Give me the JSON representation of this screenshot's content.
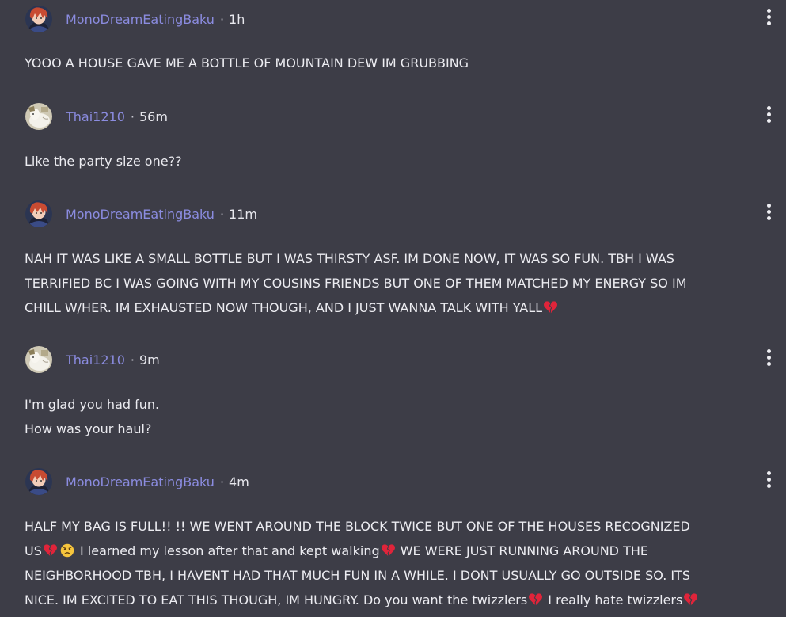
{
  "posts": [
    {
      "username": "MonoDreamEatingBaku",
      "time": "1h",
      "avatar": "mono-avatar",
      "lines": [
        "YOOO A HOUSE GAVE ME A BOTTLE OF MOUNTAIN DEW IM GRUBBING"
      ]
    },
    {
      "username": "Thai1210",
      "time": "56m",
      "avatar": "thai-avatar",
      "lines": [
        "Like the party size one??"
      ]
    },
    {
      "username": "MonoDreamEatingBaku",
      "time": "11m",
      "avatar": "mono-avatar",
      "lines": [
        "NAH IT WAS LIKE A SMALL BOTTLE BUT I WAS THIRSTY ASF. IM DONE NOW, IT WAS SO FUN. TBH I WAS",
        "TERRIFIED BC I WAS GOING WITH MY COUSINS FRIENDS BUT ONE OF THEM MATCHED MY ENERGY SO IM",
        "CHILL W/HER. IM EXHAUSTED NOW THOUGH, AND I JUST WANNA TALK WITH YALL"
      ]
    },
    {
      "username": "Thai1210",
      "time": "9m",
      "avatar": "thai-avatar",
      "lines": [
        "I'm glad you had fun.",
        "How was your haul?"
      ]
    },
    {
      "username": "MonoDreamEatingBaku",
      "time": "4m",
      "avatar": "mono-avatar",
      "lines": [
        "HALF MY BAG IS FULL!! !! WE WENT AROUND THE BLOCK TWICE BUT ONE OF THE HOUSES RECOGNIZED",
        "US",
        "I learned my lesson after that and kept walking",
        "WE WERE JUST RUNNING AROUND THE",
        "NEIGHBORHOOD TBH, I HAVENT HAD THAT MUCH FUN IN A WHILE. I DONT USUALLY GO OUTSIDE SO. ITS",
        "NICE. IM EXCITED TO EAT THIS THOUGH, IM HUNGRY. Do you want the twizzlers",
        "I really hate twizzlers"
      ]
    }
  ],
  "separator": "·",
  "emoji": {
    "broken_heart": "broken-heart-icon",
    "sad_face": "sad-face-icon"
  },
  "colors": {
    "background": "#3d3d47",
    "username": "#8b8ce0",
    "text": "#ececf1"
  }
}
